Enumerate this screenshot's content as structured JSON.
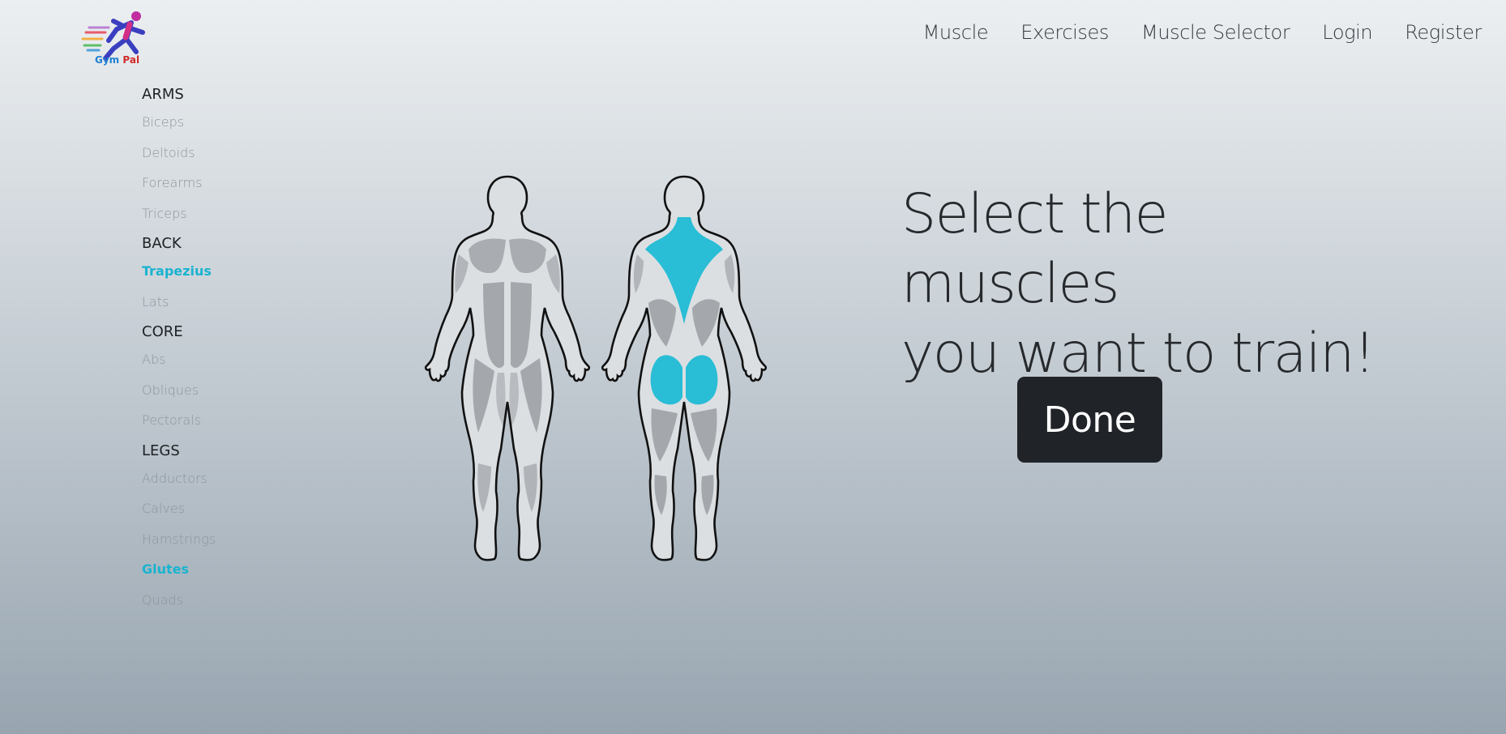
{
  "brand": {
    "name_part1": "Gym",
    "name_part2": "Pal"
  },
  "nav": {
    "items": [
      "Muscle",
      "Exercises",
      "Muscle Selector",
      "Login",
      "Register"
    ]
  },
  "sidebar": {
    "groups": [
      {
        "title": "ARMS",
        "items": [
          "Biceps",
          "Deltoids",
          "Forearms",
          "Triceps"
        ]
      },
      {
        "title": "BACK",
        "items": [
          "Trapezius",
          "Lats"
        ]
      },
      {
        "title": "CORE",
        "items": [
          "Abs",
          "Obliques",
          "Pectorals"
        ]
      },
      {
        "title": "LEGS",
        "items": [
          "Adductors",
          "Calves",
          "Hamstrings",
          "Glutes",
          "Quads"
        ]
      }
    ],
    "selected": [
      "Trapezius",
      "Glutes"
    ]
  },
  "main": {
    "headline_line1": "Select the muscles",
    "headline_line2": "you want to train!",
    "done_label": "Done"
  },
  "colors": {
    "selected_accent": "#1ab3cf",
    "muscle_highlight": "#29bdd6",
    "muscle_default": "#a4a8ac",
    "button_bg": "#202327"
  },
  "icons": {
    "logo": "runner-logo-icon"
  }
}
